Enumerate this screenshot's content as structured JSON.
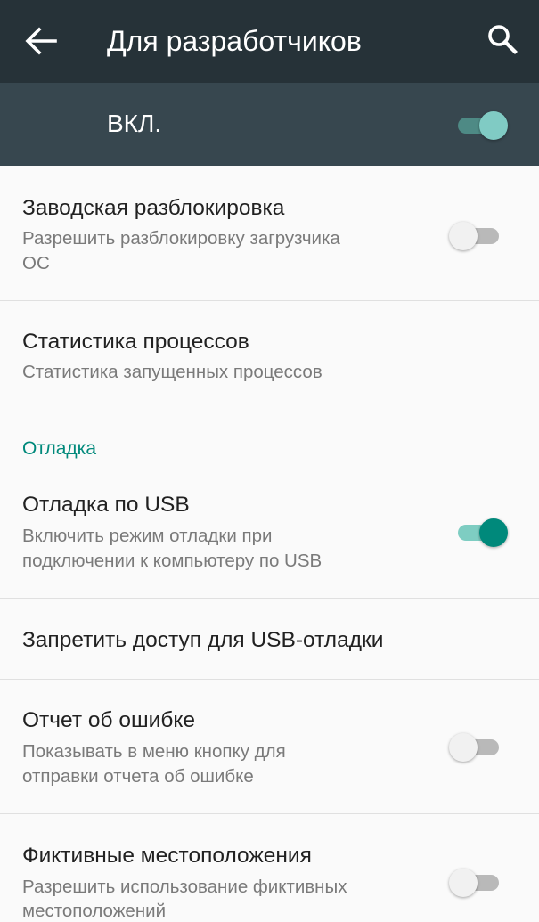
{
  "appbar": {
    "title": "Для разработчиков",
    "back_icon": "arrow-back-icon",
    "search_icon": "search-icon"
  },
  "master": {
    "label": "ВКЛ.",
    "enabled": true
  },
  "items": [
    {
      "title": "Заводская разблокировка",
      "subtitle_line1": "Разрешить разблокировку загрузчика",
      "subtitle_line2": "ОС",
      "switch_on": false
    },
    {
      "title": "Статистика процессов",
      "subtitle_line1": "Статистика запущенных процессов"
    }
  ],
  "category": {
    "label": "Отладка"
  },
  "debug_items": [
    {
      "title": "Отладка по USB",
      "subtitle_line1": "Включить режим отладки при",
      "subtitle_line2": "подключении к компьютеру по USB",
      "switch_on": true
    },
    {
      "title": "Запретить доступ для USB-отладки"
    },
    {
      "title": "Отчет об ошибке",
      "subtitle_line1": "Показывать в меню кнопку для",
      "subtitle_line2": "отправки отчета об ошибке",
      "switch_on": false
    },
    {
      "title": "Фиктивные местоположения",
      "subtitle_line1": "Разрешить использование фиктивных",
      "subtitle_line2": "местоположений",
      "switch_on": false
    }
  ],
  "colors": {
    "appbar": "#263238",
    "masterbar": "#37474f",
    "accent": "#00897b",
    "background": "#fafafa"
  }
}
